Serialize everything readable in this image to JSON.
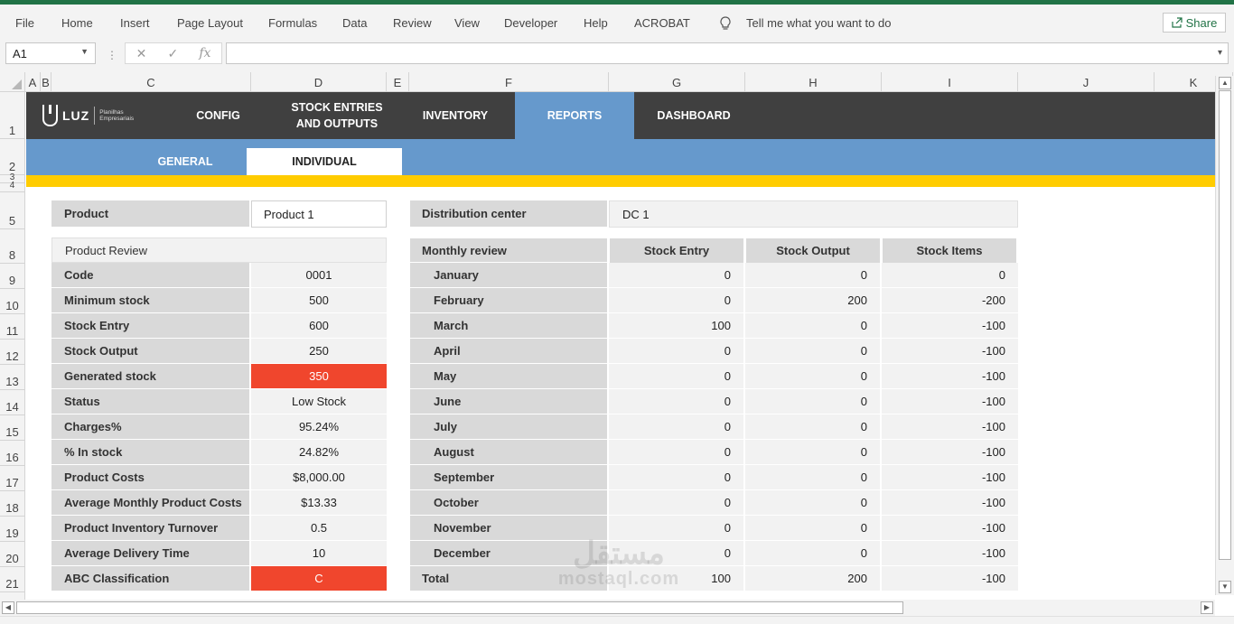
{
  "ribbon": {
    "tabs": [
      "File",
      "Home",
      "Insert",
      "Page Layout",
      "Formulas",
      "Data",
      "Review",
      "View",
      "Developer",
      "Help",
      "ACROBAT"
    ],
    "tell_me": "Tell me what you want to do",
    "share_label": "Share"
  },
  "formula_bar": {
    "name_box": "A1",
    "cancel": "✕",
    "enter": "✓",
    "fx": "fx",
    "value": ""
  },
  "columns": [
    "A",
    "B",
    "C",
    "D",
    "E",
    "F",
    "G",
    "H",
    "I",
    "J",
    "K"
  ],
  "rows": [
    "1",
    "2",
    "3",
    "4",
    "5",
    "8",
    "9",
    "10",
    "11",
    "12",
    "13",
    "14",
    "15",
    "16",
    "17",
    "18",
    "19",
    "20",
    "21"
  ],
  "nav": {
    "logo_text": "LUZ",
    "logo_sub1": "Planilhas",
    "logo_sub2": "Empresariais",
    "items": [
      "CONFIG",
      "STOCK ENTRIES AND OUTPUTS",
      "INVENTORY",
      "REPORTS",
      "DASHBOARD"
    ],
    "active": "REPORTS"
  },
  "subnav": {
    "items": [
      "GENERAL",
      "INDIVIDUAL"
    ],
    "active": "INDIVIDUAL"
  },
  "product": {
    "label": "Product",
    "value": "Product 1"
  },
  "distribution": {
    "label": "Distribution center",
    "value": "DC 1"
  },
  "product_review": {
    "title": "Product Review",
    "rows": [
      {
        "label": "Code",
        "value": "0001",
        "alert": false
      },
      {
        "label": "Minimum stock",
        "value": "500",
        "alert": false
      },
      {
        "label": "Stock Entry",
        "value": "600",
        "alert": false
      },
      {
        "label": "Stock Output",
        "value": "250",
        "alert": false
      },
      {
        "label": "Generated stock",
        "value": "350",
        "alert": true
      },
      {
        "label": "Status",
        "value": "Low Stock",
        "alert": false
      },
      {
        "label": "Charges%",
        "value": "95.24%",
        "alert": false
      },
      {
        "label": "% In stock",
        "value": "24.82%",
        "alert": false
      },
      {
        "label": "Product Costs",
        "value": "$8,000.00",
        "alert": false
      },
      {
        "label": "Average Monthly Product Costs",
        "value": "$13.33",
        "alert": false
      },
      {
        "label": "Product Inventory Turnover",
        "value": "0.5",
        "alert": false
      },
      {
        "label": "Average Delivery Time",
        "value": "10",
        "alert": false
      },
      {
        "label": "ABC Classification",
        "value": "C",
        "alert": true
      }
    ]
  },
  "monthly_review": {
    "title": "Monthly review",
    "headers": [
      "Stock Entry",
      "Stock Output",
      "Stock Items"
    ],
    "rows": [
      {
        "month": "January",
        "entry": "0",
        "output": "0",
        "items": "0"
      },
      {
        "month": "February",
        "entry": "0",
        "output": "200",
        "items": "-200"
      },
      {
        "month": "March",
        "entry": "100",
        "output": "0",
        "items": "-100"
      },
      {
        "month": "April",
        "entry": "0",
        "output": "0",
        "items": "-100"
      },
      {
        "month": "May",
        "entry": "0",
        "output": "0",
        "items": "-100"
      },
      {
        "month": "June",
        "entry": "0",
        "output": "0",
        "items": "-100"
      },
      {
        "month": "July",
        "entry": "0",
        "output": "0",
        "items": "-100"
      },
      {
        "month": "August",
        "entry": "0",
        "output": "0",
        "items": "-100"
      },
      {
        "month": "September",
        "entry": "0",
        "output": "0",
        "items": "-100"
      },
      {
        "month": "October",
        "entry": "0",
        "output": "0",
        "items": "-100"
      },
      {
        "month": "November",
        "entry": "0",
        "output": "0",
        "items": "-100"
      },
      {
        "month": "December",
        "entry": "0",
        "output": "0",
        "items": "-100"
      },
      {
        "month": "Total",
        "entry": "100",
        "output": "200",
        "items": "-100"
      }
    ]
  },
  "watermark": {
    "ar": "مستقل",
    "en": "mostaql.com"
  },
  "colors": {
    "nav_bg": "#404040",
    "accent_blue": "#6699cc",
    "yellow": "#ffcc00",
    "alert_red": "#f0462d",
    "excel_green": "#217346"
  }
}
